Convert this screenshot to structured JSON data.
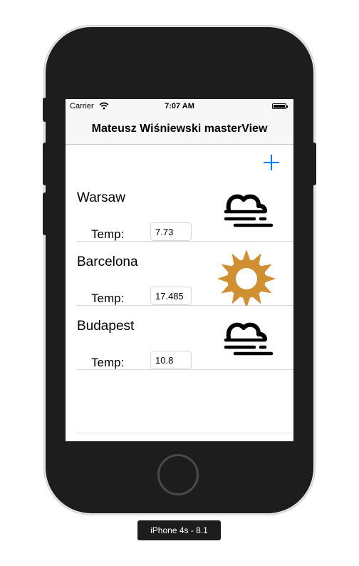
{
  "status_bar": {
    "carrier": "Carrier",
    "time": "7:07 AM"
  },
  "nav": {
    "title": "Mateusz Wiśniewski masterView",
    "add_icon": "plus-icon",
    "accent": "#0a7aff"
  },
  "rows": [
    {
      "city": "Warsaw",
      "temp_label": "Temp:",
      "temp_value": "7.73",
      "icon": "fog-icon"
    },
    {
      "city": "Barcelona",
      "temp_label": "Temp:",
      "temp_value": "17.485",
      "icon": "sun-icon"
    },
    {
      "city": "Budapest",
      "temp_label": "Temp:",
      "temp_value": "10.8",
      "icon": "fog-icon"
    }
  ],
  "sun_color": "#d08f30",
  "device_label": "iPhone 4s - 8.1"
}
